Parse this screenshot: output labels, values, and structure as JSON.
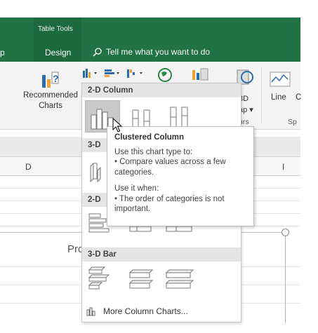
{
  "ribbon": {
    "tab_group_label": "Table Tools",
    "tab_partial": "p",
    "tab_design": "Design",
    "tell_me": "Tell me what you want to do",
    "recommended_label_1": "Recommended",
    "recommended_label_2": "Charts",
    "map_label_1": "3D",
    "map_label_2": "ap ▾",
    "map_label_3": "urs",
    "line_label": "Line",
    "partial_c_label": "C",
    "sp_label": "Sp"
  },
  "sheet": {
    "col_d": "D",
    "col_i": "I",
    "chart_title_partial": "Pro"
  },
  "dropdown": {
    "section_2d_column": "2-D Column",
    "section_3d_column_partial": "3-D",
    "section_2d_bar_partial": "2-D",
    "section_3d_bar": "3-D Bar",
    "more_column_charts": "More Column Charts..."
  },
  "tooltip": {
    "title": "Clustered Column",
    "line1": "Use this chart type to:",
    "line2": "• Compare values across a few categories.",
    "line3": "Use it when:",
    "line4": "• The order of categories is not important."
  },
  "colors": {
    "ribbon_green": "#217346",
    "ribbon_green_dark": "#1c6a3e",
    "accent_blue": "#2b6cb0",
    "accent_orange": "#f0a030"
  },
  "icons": [
    "search-icon",
    "recommended-charts-icon",
    "column-chart-icon",
    "bar-chart-icon",
    "waterfall-chart-icon",
    "map-chart-icon",
    "line-sparkline-icon",
    "mouse-pointer-icon"
  ]
}
